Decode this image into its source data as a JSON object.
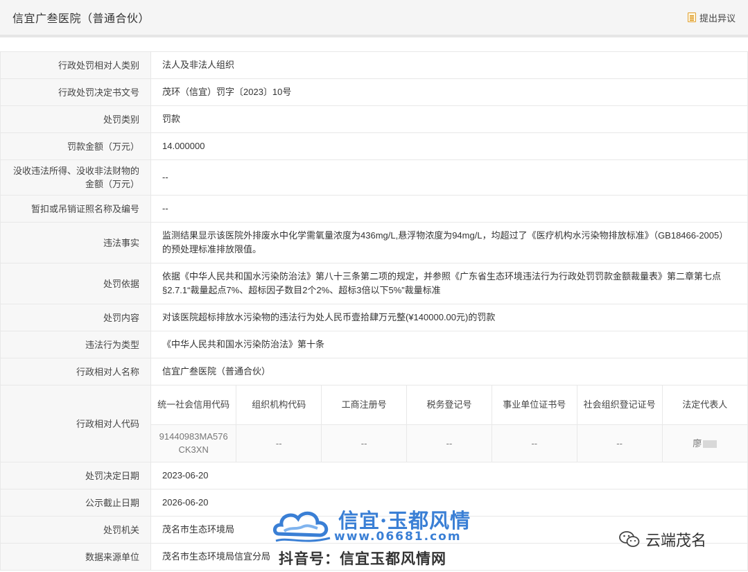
{
  "header": {
    "title": "信宜广叁医院（普通合伙）",
    "objection_label": "提出异议"
  },
  "rows": [
    {
      "label": "行政处罚相对人类别",
      "value": "法人及非法人组织"
    },
    {
      "label": "行政处罚决定书文号",
      "value": "茂环（信宜）罚字〔2023〕10号"
    },
    {
      "label": "处罚类别",
      "value": "罚款"
    },
    {
      "label": "罚款金额（万元）",
      "value": "14.000000"
    },
    {
      "label": "没收违法所得、没收非法财物的金额（万元）",
      "value": "--"
    },
    {
      "label": "暂扣或吊销证照名称及编号",
      "value": "--"
    },
    {
      "label": "违法事实",
      "value": "监测结果显示该医院外排废水中化学需氧量浓度为436mg/L,悬浮物浓度为94mg/L，均超过了《医疗机构水污染物排放标准》（GB18466-2005）的预处理标准排放限值。"
    },
    {
      "label": "处罚依据",
      "value": "依据《中华人民共和国水污染防治法》第八十三条第二项的规定，并参照《广东省生态环境违法行为行政处罚罚款金额裁量表》第二章第七点§2.7.1“裁量起点7%、超标因子数目2个2%、超标3倍以下5%”裁量标准"
    },
    {
      "label": "处罚内容",
      "value": "对该医院超标排放水污染物的违法行为处人民币壹拾肆万元整(¥140000.00元)的罚款"
    },
    {
      "label": "违法行为类型",
      "value": "《中华人民共和国水污染防治法》第十条"
    },
    {
      "label": "行政相对人名称",
      "value": "信宜广叁医院（普通合伙）"
    }
  ],
  "codes": {
    "label": "行政相对人代码",
    "headers": [
      "统一社会信用代码",
      "组织机构代码",
      "工商注册号",
      "税务登记号",
      "事业单位证书号",
      "社会组织登记证号",
      "法定代表人"
    ],
    "values": [
      "91440983MA576CK3XN",
      "--",
      "--",
      "--",
      "--",
      "--",
      "廖"
    ]
  },
  "rows_after": [
    {
      "label": "处罚决定日期",
      "value": "2023-06-20"
    },
    {
      "label": "公示截止日期",
      "value": "2026-06-20"
    },
    {
      "label": "处罚机关",
      "value": "茂名市生态环境局"
    },
    {
      "label": "数据来源单位",
      "value": "茂名市生态环境局信宜分局"
    }
  ],
  "watermark": {
    "brand": "信宜·玉都风情",
    "url": "www.06681.com",
    "douyin": "抖音号：信宜玉都风情网",
    "wechat": "云端茂名"
  },
  "colors": {
    "watermark_blue": "#3a7fd5",
    "label_bg": "#f7f7f7",
    "border": "#e8e8e8"
  }
}
